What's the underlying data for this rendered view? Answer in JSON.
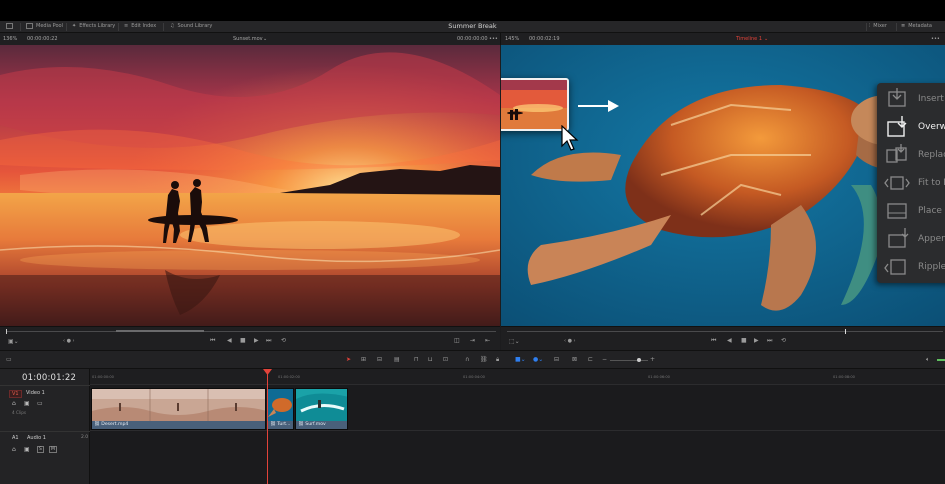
{
  "toolbar": {
    "media_pool": "Media Pool",
    "effects_library": "Effects Library",
    "edit_index": "Edit Index",
    "sound_library": "Sound Library",
    "project_title": "Summer Break",
    "mixer": "Mixer",
    "metadata": "Metadata"
  },
  "source_viewer": {
    "zoom": "136%",
    "timecode": "00:00:00:22",
    "clip_name": "Sunset.mov",
    "chevron": "⌄",
    "out_timecode": "00:00:00:00"
  },
  "timeline_viewer": {
    "zoom": "145%",
    "timecode": "00:00:02:19",
    "timeline_name": "Timeline 1",
    "chevron": "⌄"
  },
  "context_menu": {
    "items": [
      {
        "label": "Insert",
        "icon": "insert-icon"
      },
      {
        "label": "Overwrite",
        "icon": "overwrite-icon",
        "active": true
      },
      {
        "label": "Replace",
        "icon": "replace-icon"
      },
      {
        "label": "Fit to Fill",
        "icon": "fit-to-fill-icon"
      },
      {
        "label": "Place on Top",
        "icon": "place-on-top-icon"
      },
      {
        "label": "Append at End",
        "icon": "append-icon"
      },
      {
        "label": "Ripple Overwrite",
        "icon": "ripple-overwrite-icon"
      }
    ]
  },
  "timeline": {
    "current_timecode": "01:00:01:22",
    "ruler": [
      "01:00:00:00",
      "01:00:02:00",
      "01:00:04:00",
      "01:00:06:00",
      "01:00:08:00"
    ],
    "video_track": {
      "id": "V1",
      "name": "Video 1",
      "info": "4 Clips"
    },
    "audio_track": {
      "id": "A1",
      "name": "Audio 1",
      "channel": "2.0",
      "solo": "S",
      "mute": "M"
    },
    "clips": [
      {
        "name": "Desert.mp4"
      },
      {
        "name": "Turt..."
      },
      {
        "name": "Surf.mov"
      }
    ]
  },
  "colors": {
    "playhead": "#e2433a",
    "clip_label": "#49607a",
    "accent_blue": "#2f7ff0"
  }
}
